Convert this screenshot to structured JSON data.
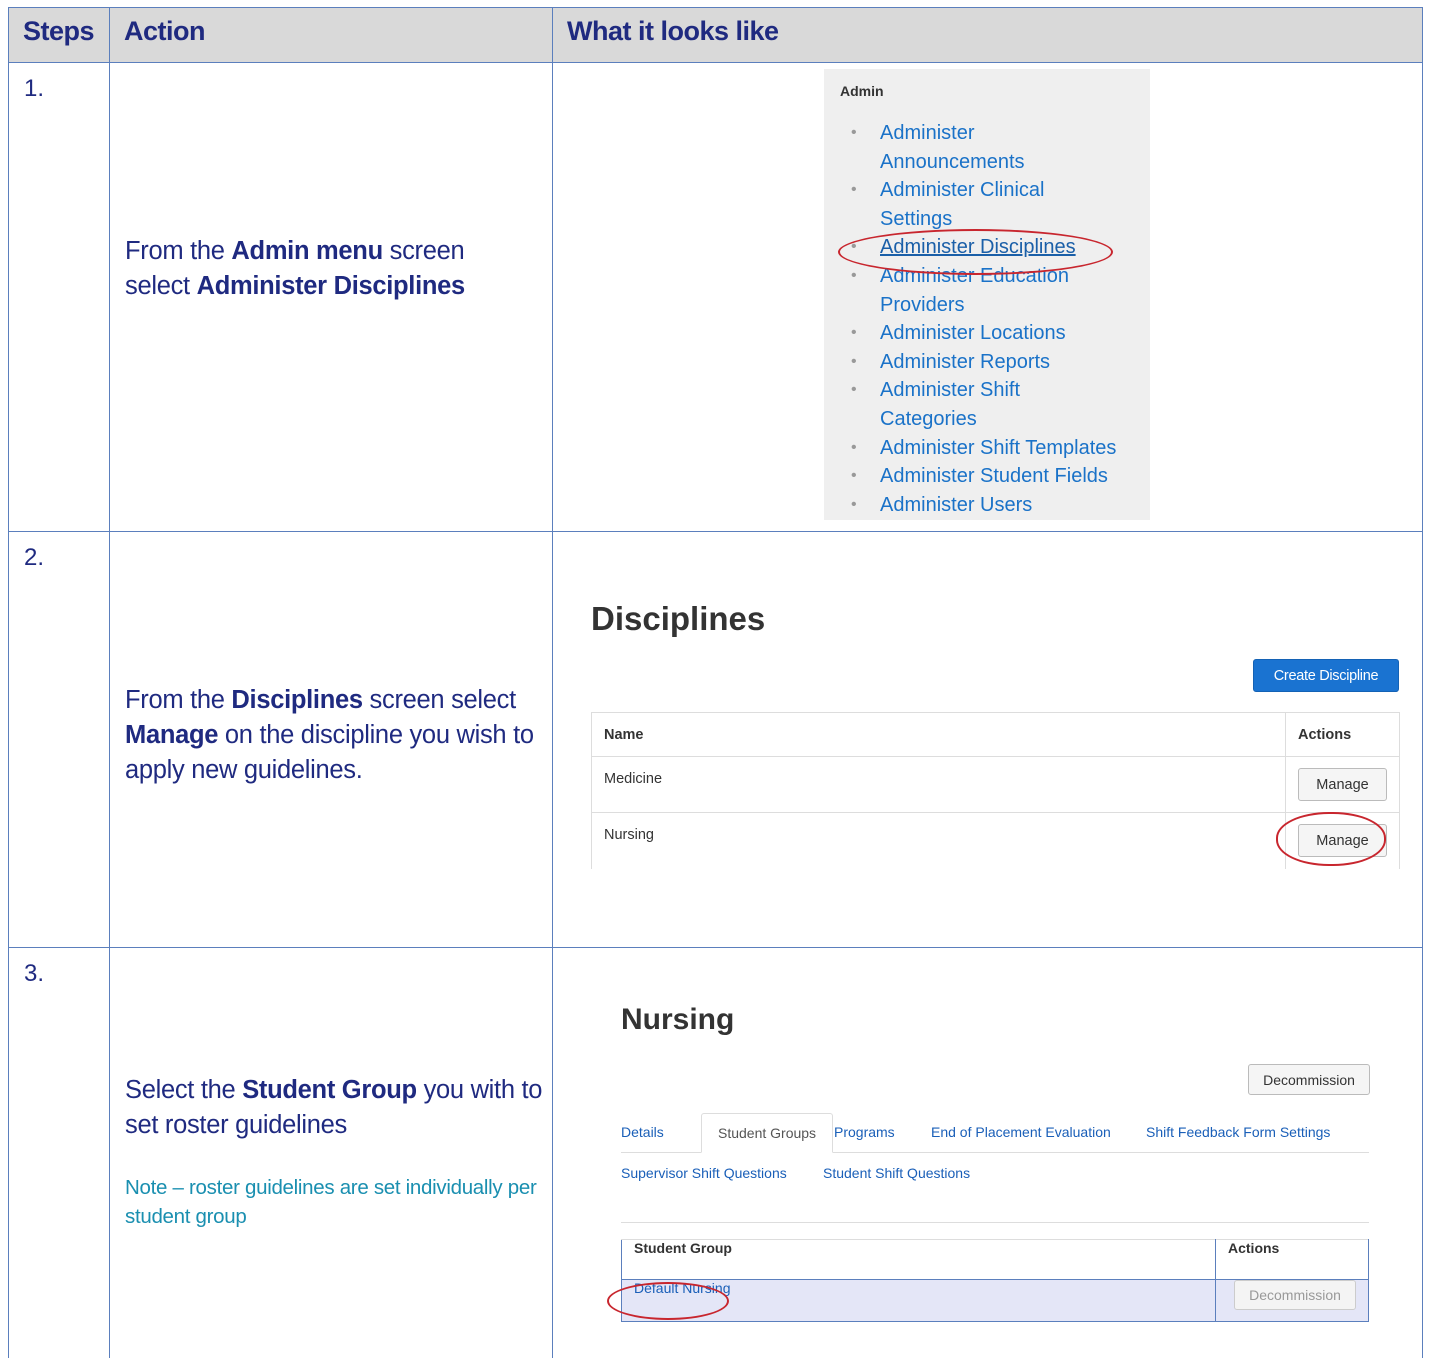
{
  "headers": {
    "steps": "Steps",
    "action": "Action",
    "looks": "What it looks like"
  },
  "step1": {
    "num": "1.",
    "action": {
      "t1": "From the ",
      "b1": "Admin menu",
      "t2": " screen select ",
      "b2": "Administer Disciplines"
    },
    "admin": {
      "title": "Admin",
      "items": [
        {
          "l1": "Administer",
          "l2": "Announcements"
        },
        {
          "l1": "Administer Clinical",
          "l2": "Settings"
        },
        {
          "l1": "Administer Disciplines"
        },
        {
          "l1": "Administer Education",
          "l2": "Providers"
        },
        {
          "l1": "Administer Locations"
        },
        {
          "l1": "Administer Reports"
        },
        {
          "l1": "Administer Shift",
          "l2": "Categories"
        },
        {
          "l1": "Administer Shift Templates"
        },
        {
          "l1": "Administer Student Fields"
        },
        {
          "l1": "Administer Users"
        }
      ]
    }
  },
  "step2": {
    "num": "2.",
    "action": {
      "t1": "From the ",
      "b1": "Disciplines",
      "t2": " screen select ",
      "b2": "Manage",
      "t3": " on the discipline you wish to apply new guidelines."
    },
    "disc": {
      "title": "Disciplines",
      "create_btn": "Create Discipline",
      "col_name": "Name",
      "col_actions": "Actions",
      "rows": [
        {
          "name": "Medicine",
          "btn": "Manage"
        },
        {
          "name": "Nursing",
          "btn": "Manage"
        }
      ]
    }
  },
  "step3": {
    "num": "3.",
    "action": {
      "t1": "Select the ",
      "b1": "Student Group",
      "t2": " you with to set roster guidelines"
    },
    "note": "Note – roster guidelines are set individually per student group",
    "nurs": {
      "title": "Nursing",
      "decom_btn": "Decommission",
      "tabs": [
        "Details",
        "Student Groups",
        "Programs",
        "End of Placement Evaluation",
        "Shift Feedback Form Settings",
        "Supervisor Shift Questions",
        "Student Shift Questions"
      ],
      "col_group": "Student Group",
      "col_actions": "Actions",
      "row": {
        "group": "Default Nursing",
        "btn": "Decommission"
      }
    }
  },
  "colors": {
    "border": "#5b7fbd",
    "text": "#1f2a80",
    "note": "#1a8fb0",
    "highlight_oval": "#c8262e",
    "link": "#1a72c8",
    "primary": "#1a73d1"
  }
}
